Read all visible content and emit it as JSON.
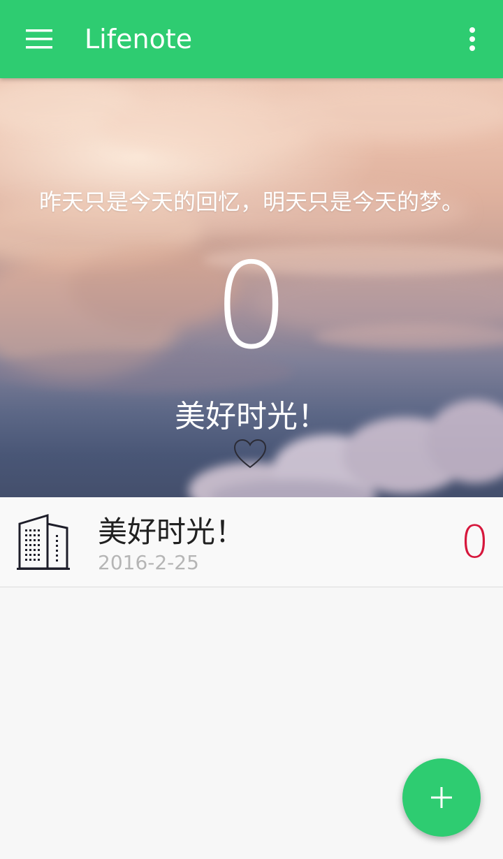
{
  "app_bar": {
    "title": "Lifenote",
    "menu_icon": "menu-icon",
    "overflow_icon": "more-vert-icon",
    "color": "#2ecc71"
  },
  "hero": {
    "quote": "昨天只是今天的回忆，明天只是今天的梦。",
    "count": "0",
    "title": "美好时光！",
    "heart_icon": "heart-outline-icon"
  },
  "list": {
    "items": [
      {
        "icon": "building-icon",
        "title": "美好时光！",
        "date": "2016-2-25",
        "count": "0",
        "count_color": "#d6173c"
      }
    ]
  },
  "fab": {
    "icon": "plus-icon",
    "label": "+"
  }
}
